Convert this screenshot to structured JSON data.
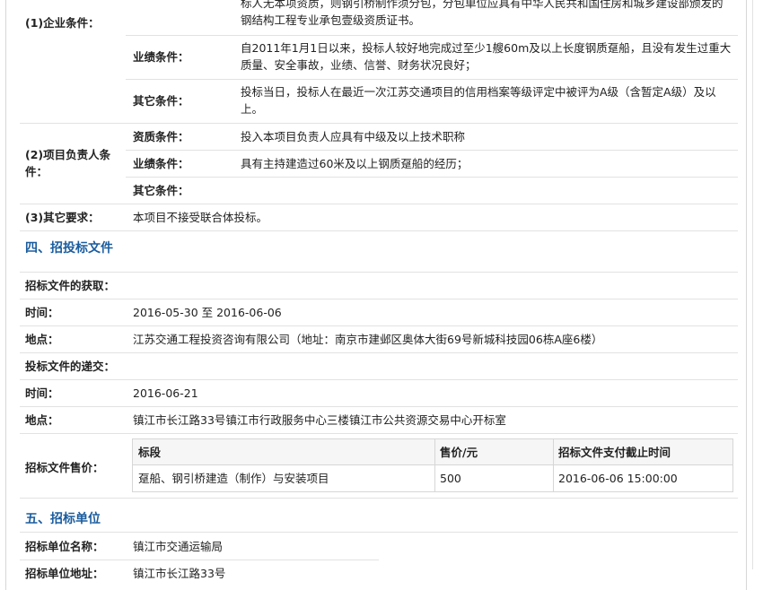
{
  "enterprise": {
    "label": "(1)企业条件：",
    "qualification_text": "标人无本项资质，则钢引桥制作须分包，分包单位应具有中华人民共和国住房和城乡建设部颁发的钢结构工程专业承包壹级资质证书。",
    "performance_label": "业绩条件：",
    "performance_text": "自2011年1月1日以来，投标人较好地完成过至少1艘60m及以上长度钢质趸船，且没有发生过重大质量、安全事故，业绩、信誉、财务状况良好；",
    "other_label": "其它条件：",
    "other_text": "投标当日，投标人在最近一次江苏交通项目的信用档案等级评定中被评为A级（含暂定A级）及以上。"
  },
  "manager": {
    "label": "(2)项目负责人条件：",
    "qualification_label": "资质条件：",
    "qualification_text": "投入本项目负责人应具有中级及以上技术职称",
    "performance_label": "业绩条件：",
    "performance_text": "具有主持建造过60米及以上钢质趸船的经历；",
    "other_label": "其它条件：",
    "other_text": ""
  },
  "other_requirements": {
    "label": "(3)其它要求：",
    "text": "本项目不接受联合体投标。"
  },
  "section4": {
    "title": "四、招投标文件",
    "obtain_label": "招标文件的获取：",
    "time_label": "时间：",
    "time_value": "2016-05-30 至 2016-06-06",
    "place_label": "地点：",
    "place_value": "江苏交通工程投资咨询有限公司（地址：南京市建邺区奥体大街69号新城科技园06栋A座6楼）",
    "submit_label": "投标文件的递交：",
    "submit_time_label": "时间：",
    "submit_time_value": "2016-06-21",
    "submit_place_label": "地点：",
    "submit_place_value": "镇江市长江路33号镇江市行政服务中心三楼镇江市公共资源交易中心开标室",
    "price_label": "招标文件售价：",
    "price_table": {
      "headers": [
        "标段",
        "售价/元",
        "招标文件支付截止时间"
      ],
      "rows": [
        [
          "趸船、钢引桥建造（制作）与安装项目",
          "500",
          "2016-06-06 15:00:00"
        ]
      ]
    }
  },
  "section5": {
    "title": "五、招标单位",
    "name_label": "招标单位名称：",
    "name_value": "镇江市交通运输局",
    "address_label": "招标单位地址：",
    "address_value": "镇江市长江路33号"
  }
}
